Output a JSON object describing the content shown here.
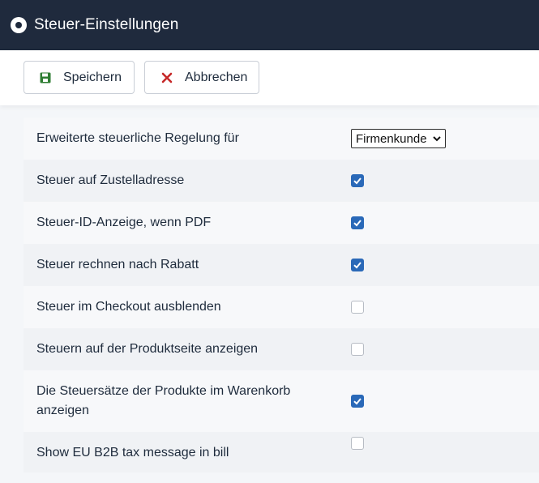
{
  "header": {
    "title": "Steuer-Einstellungen",
    "icon": "radio-dot-icon"
  },
  "toolbar": {
    "save_label": "Speichern",
    "save_icon": "floppy-disk-icon",
    "cancel_label": "Abbrechen",
    "cancel_icon": "close-x-icon"
  },
  "settings": [
    {
      "label": "Erweiterte steuerliche Regelung für",
      "control": "select",
      "value": "Firmenkunde"
    },
    {
      "label": "Steuer auf Zustelladresse",
      "control": "checkbox",
      "checked": true
    },
    {
      "label": "Steuer-ID-Anzeige, wenn PDF",
      "control": "checkbox",
      "checked": true
    },
    {
      "label": "Steuer rechnen nach Rabatt",
      "control": "checkbox",
      "checked": true
    },
    {
      "label": "Steuer im Checkout ausblenden",
      "control": "checkbox",
      "checked": false
    },
    {
      "label": "Steuern auf der Produktseite anzeigen",
      "control": "checkbox",
      "checked": false
    },
    {
      "label": "Die Steuersätze der Produkte im Warenkorb anzeigen",
      "control": "checkbox",
      "checked": true
    },
    {
      "label": "Show EU B2B tax message in bill",
      "control": "checkbox",
      "checked": false
    }
  ],
  "colors": {
    "header_bg": "#1f2a3d",
    "accent_checkbox": "#2a69b8",
    "save_icon": "#2e7d32",
    "cancel_icon": "#c62828"
  }
}
